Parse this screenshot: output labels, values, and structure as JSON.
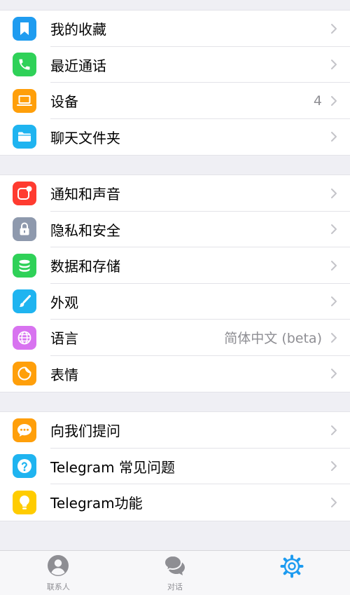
{
  "colors": {
    "saved": "#1f9cf0",
    "calls": "#2fd158",
    "devices": "#ff9f0a",
    "folders": "#1fb4f0",
    "notifications": "#ff3b30",
    "privacy": "#8e99ad",
    "data": "#2fd158",
    "appearance": "#1fb4f0",
    "language": "#d873f0",
    "stickers": "#ff9f0a",
    "ask": "#ff9f0a",
    "faq": "#1fb4f0",
    "features": "#ffcc00",
    "tab_active": "#1d9bf0",
    "tab_inactive": "#8e8e93"
  },
  "group1": {
    "saved": {
      "label": "我的收藏",
      "icon": "bookmark-icon"
    },
    "calls": {
      "label": "最近通话",
      "icon": "phone-icon"
    },
    "devices": {
      "label": "设备",
      "icon": "laptop-icon",
      "detail": "4"
    },
    "folders": {
      "label": "聊天文件夹",
      "icon": "folder-icon"
    }
  },
  "group2": {
    "notifications": {
      "label": "通知和声音",
      "icon": "bell-badge-icon"
    },
    "privacy": {
      "label": "隐私和安全",
      "icon": "lock-icon"
    },
    "data": {
      "label": "数据和存储",
      "icon": "database-icon"
    },
    "appearance": {
      "label": "外观",
      "icon": "brush-icon"
    },
    "language": {
      "label": "语言",
      "icon": "globe-icon",
      "detail": "简体中文 (beta)"
    },
    "stickers": {
      "label": "表情",
      "icon": "sticker-icon"
    }
  },
  "group3": {
    "ask": {
      "label": "向我们提问",
      "icon": "chat-bubble-icon"
    },
    "faq": {
      "label": "Telegram 常见问题",
      "icon": "question-icon"
    },
    "features": {
      "label": "Telegram功能",
      "icon": "lightbulb-icon"
    }
  },
  "tabbar": {
    "contacts": "联系人",
    "chats": "对话",
    "settings_icon": "gear-icon"
  }
}
